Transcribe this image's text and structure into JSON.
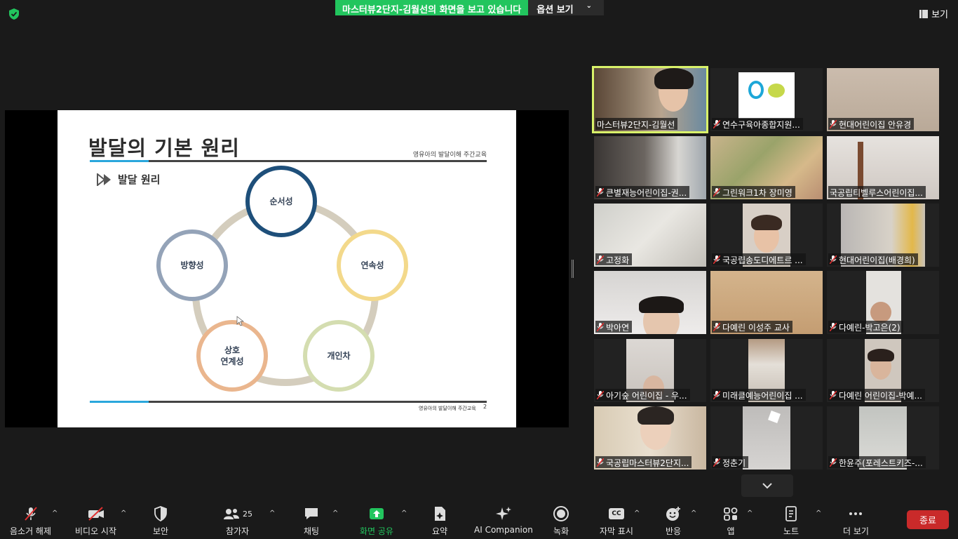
{
  "top": {
    "share_banner": "마스터뷰2단지-김월선의 화면을 보고 있습니다",
    "options_label": "옵션 보기",
    "view_label": "보기"
  },
  "slide": {
    "title": "발달의 기본 원리",
    "subtitle": "영유아의 발달이해 주간교육",
    "section_label": "발달 원리",
    "nodes": [
      "순서성",
      "연속성",
      "개인차",
      "상호",
      "연계성",
      "방향성"
    ],
    "footer": "영유아의 발달이해 주간교육",
    "page_number": "2"
  },
  "gallery": {
    "tiles": [
      {
        "name": "마스터뷰2단지-김월선",
        "muted": false,
        "active": true
      },
      {
        "name": "연수구육아종합지원...",
        "muted": true,
        "active": false
      },
      {
        "name": "현대어린이집 안유경",
        "muted": true,
        "active": false
      },
      {
        "name": "큰별재능어린이집-권...",
        "muted": true,
        "active": false
      },
      {
        "name": "그린워크1차 장미영",
        "muted": true,
        "active": false
      },
      {
        "name": "국공립티벨루스어린이집...",
        "muted": false,
        "active": false
      },
      {
        "name": "고정화",
        "muted": true,
        "active": false
      },
      {
        "name": "국공립송도디에트르 ...",
        "muted": true,
        "active": false
      },
      {
        "name": "현대어린이집(배경희)",
        "muted": true,
        "active": false
      },
      {
        "name": "박아연",
        "muted": true,
        "active": false
      },
      {
        "name": "다예린 이성주 교사",
        "muted": true,
        "active": false
      },
      {
        "name": "다예린-박고은(2)",
        "muted": true,
        "active": false
      },
      {
        "name": "아기숲 어린이집 - 우...",
        "muted": true,
        "active": false
      },
      {
        "name": "미래클예능어린이집 ...",
        "muted": true,
        "active": false
      },
      {
        "name": "다예린 어린이집-박예...",
        "muted": true,
        "active": false
      },
      {
        "name": "국공립마스터뷰2단지...",
        "muted": true,
        "active": false
      },
      {
        "name": "정춘기",
        "muted": true,
        "active": false
      },
      {
        "name": "한윤주(포레스트키즈-...",
        "muted": true,
        "active": false
      }
    ]
  },
  "toolbar": {
    "unmute": "음소거 해제",
    "start_video": "비디오 시작",
    "security": "보안",
    "participants": "참가자",
    "participants_count": "25",
    "chat": "채팅",
    "share_screen": "화면 공유",
    "summary": "요약",
    "ai_companion": "AI Companion",
    "record": "녹화",
    "captions": "자막 표시",
    "captions_badge": "CC",
    "reactions": "반응",
    "apps": "앱",
    "notes": "노트",
    "more": "더 보기",
    "end": "종료"
  },
  "colors": {
    "share_green": "#22c55e",
    "active_speaker": "#d9f26a",
    "end_red": "#c92a2a",
    "slide_accent": "#2aa7dc"
  }
}
